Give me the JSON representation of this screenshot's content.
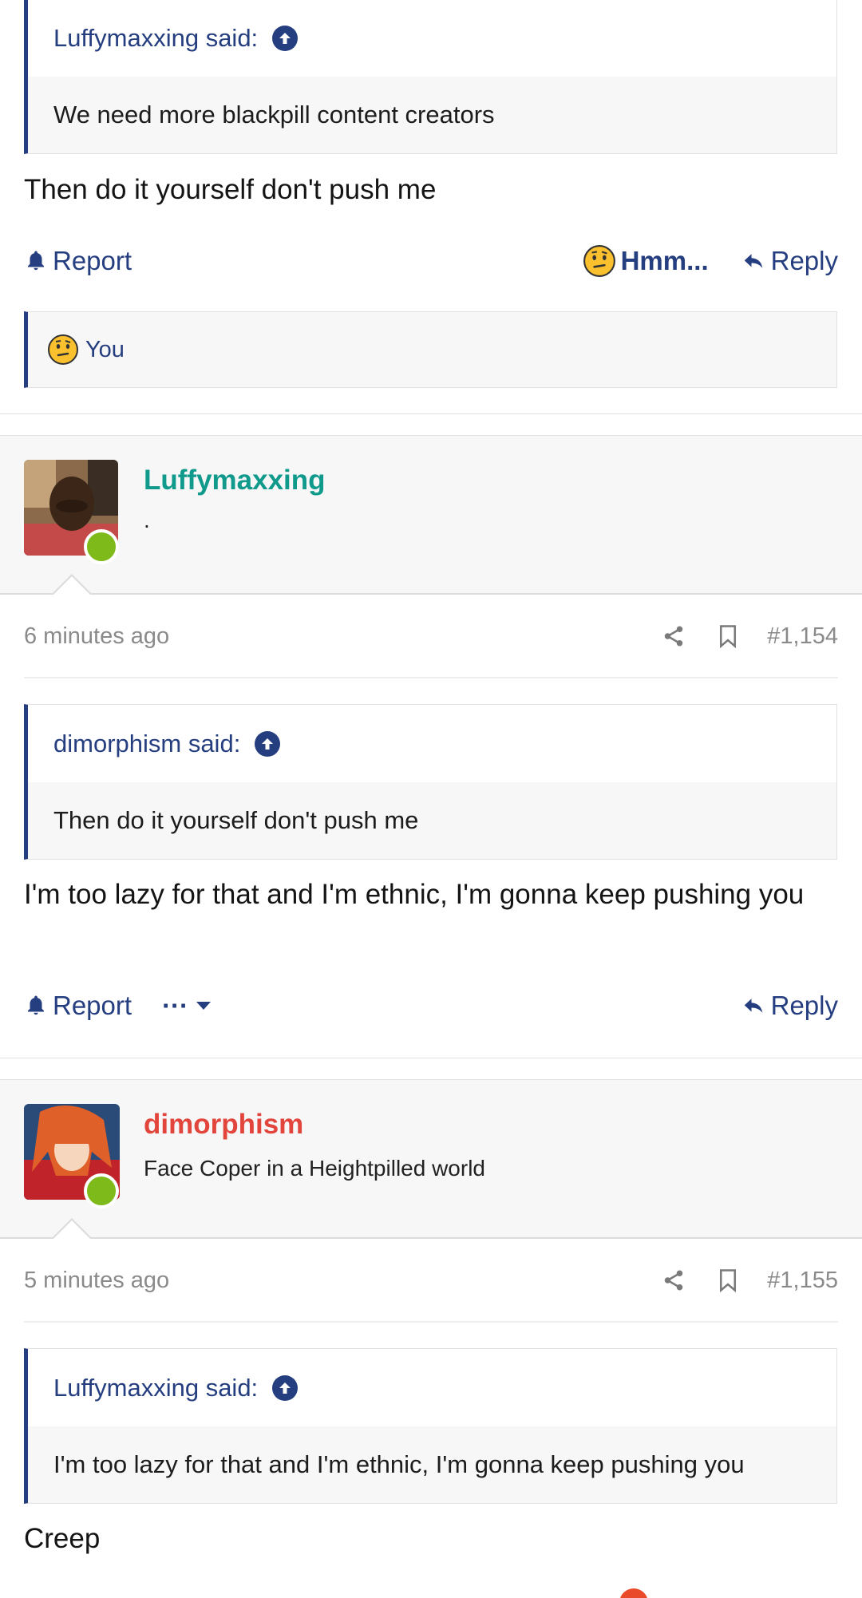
{
  "post1": {
    "quote_author": "Luffymaxxing said:",
    "quote_text": "We need more blackpill content creators",
    "message": "Then do it yourself don't push me",
    "report_label": "Report",
    "reaction_label": "Hmm...",
    "reply_label": "Reply",
    "reacted_by": "You"
  },
  "post2": {
    "username": "Luffymaxxing",
    "user_title": ".",
    "time": "6 minutes ago",
    "post_number": "#1,154",
    "quote_author": "dimorphism said:",
    "quote_text": "Then do it yourself don't push me",
    "message": "I'm too lazy for that and I'm ethnic, I'm gonna keep pushing you",
    "report_label": "Report",
    "more_label": "···",
    "reply_label": "Reply"
  },
  "post3": {
    "username": "dimorphism",
    "user_title": "Face Coper in a Heightpilled world",
    "time": "5 minutes ago",
    "post_number": "#1,155",
    "quote_author": "Luffymaxxing said:",
    "quote_text": "I'm too lazy for that and I'm ethnic, I'm gonna keep pushing you",
    "message": "Creep"
  },
  "colors": {
    "link": "#253e80",
    "username_teal": "#0f9a8c",
    "username_red": "#e2453c",
    "online": "#7fba1b"
  }
}
